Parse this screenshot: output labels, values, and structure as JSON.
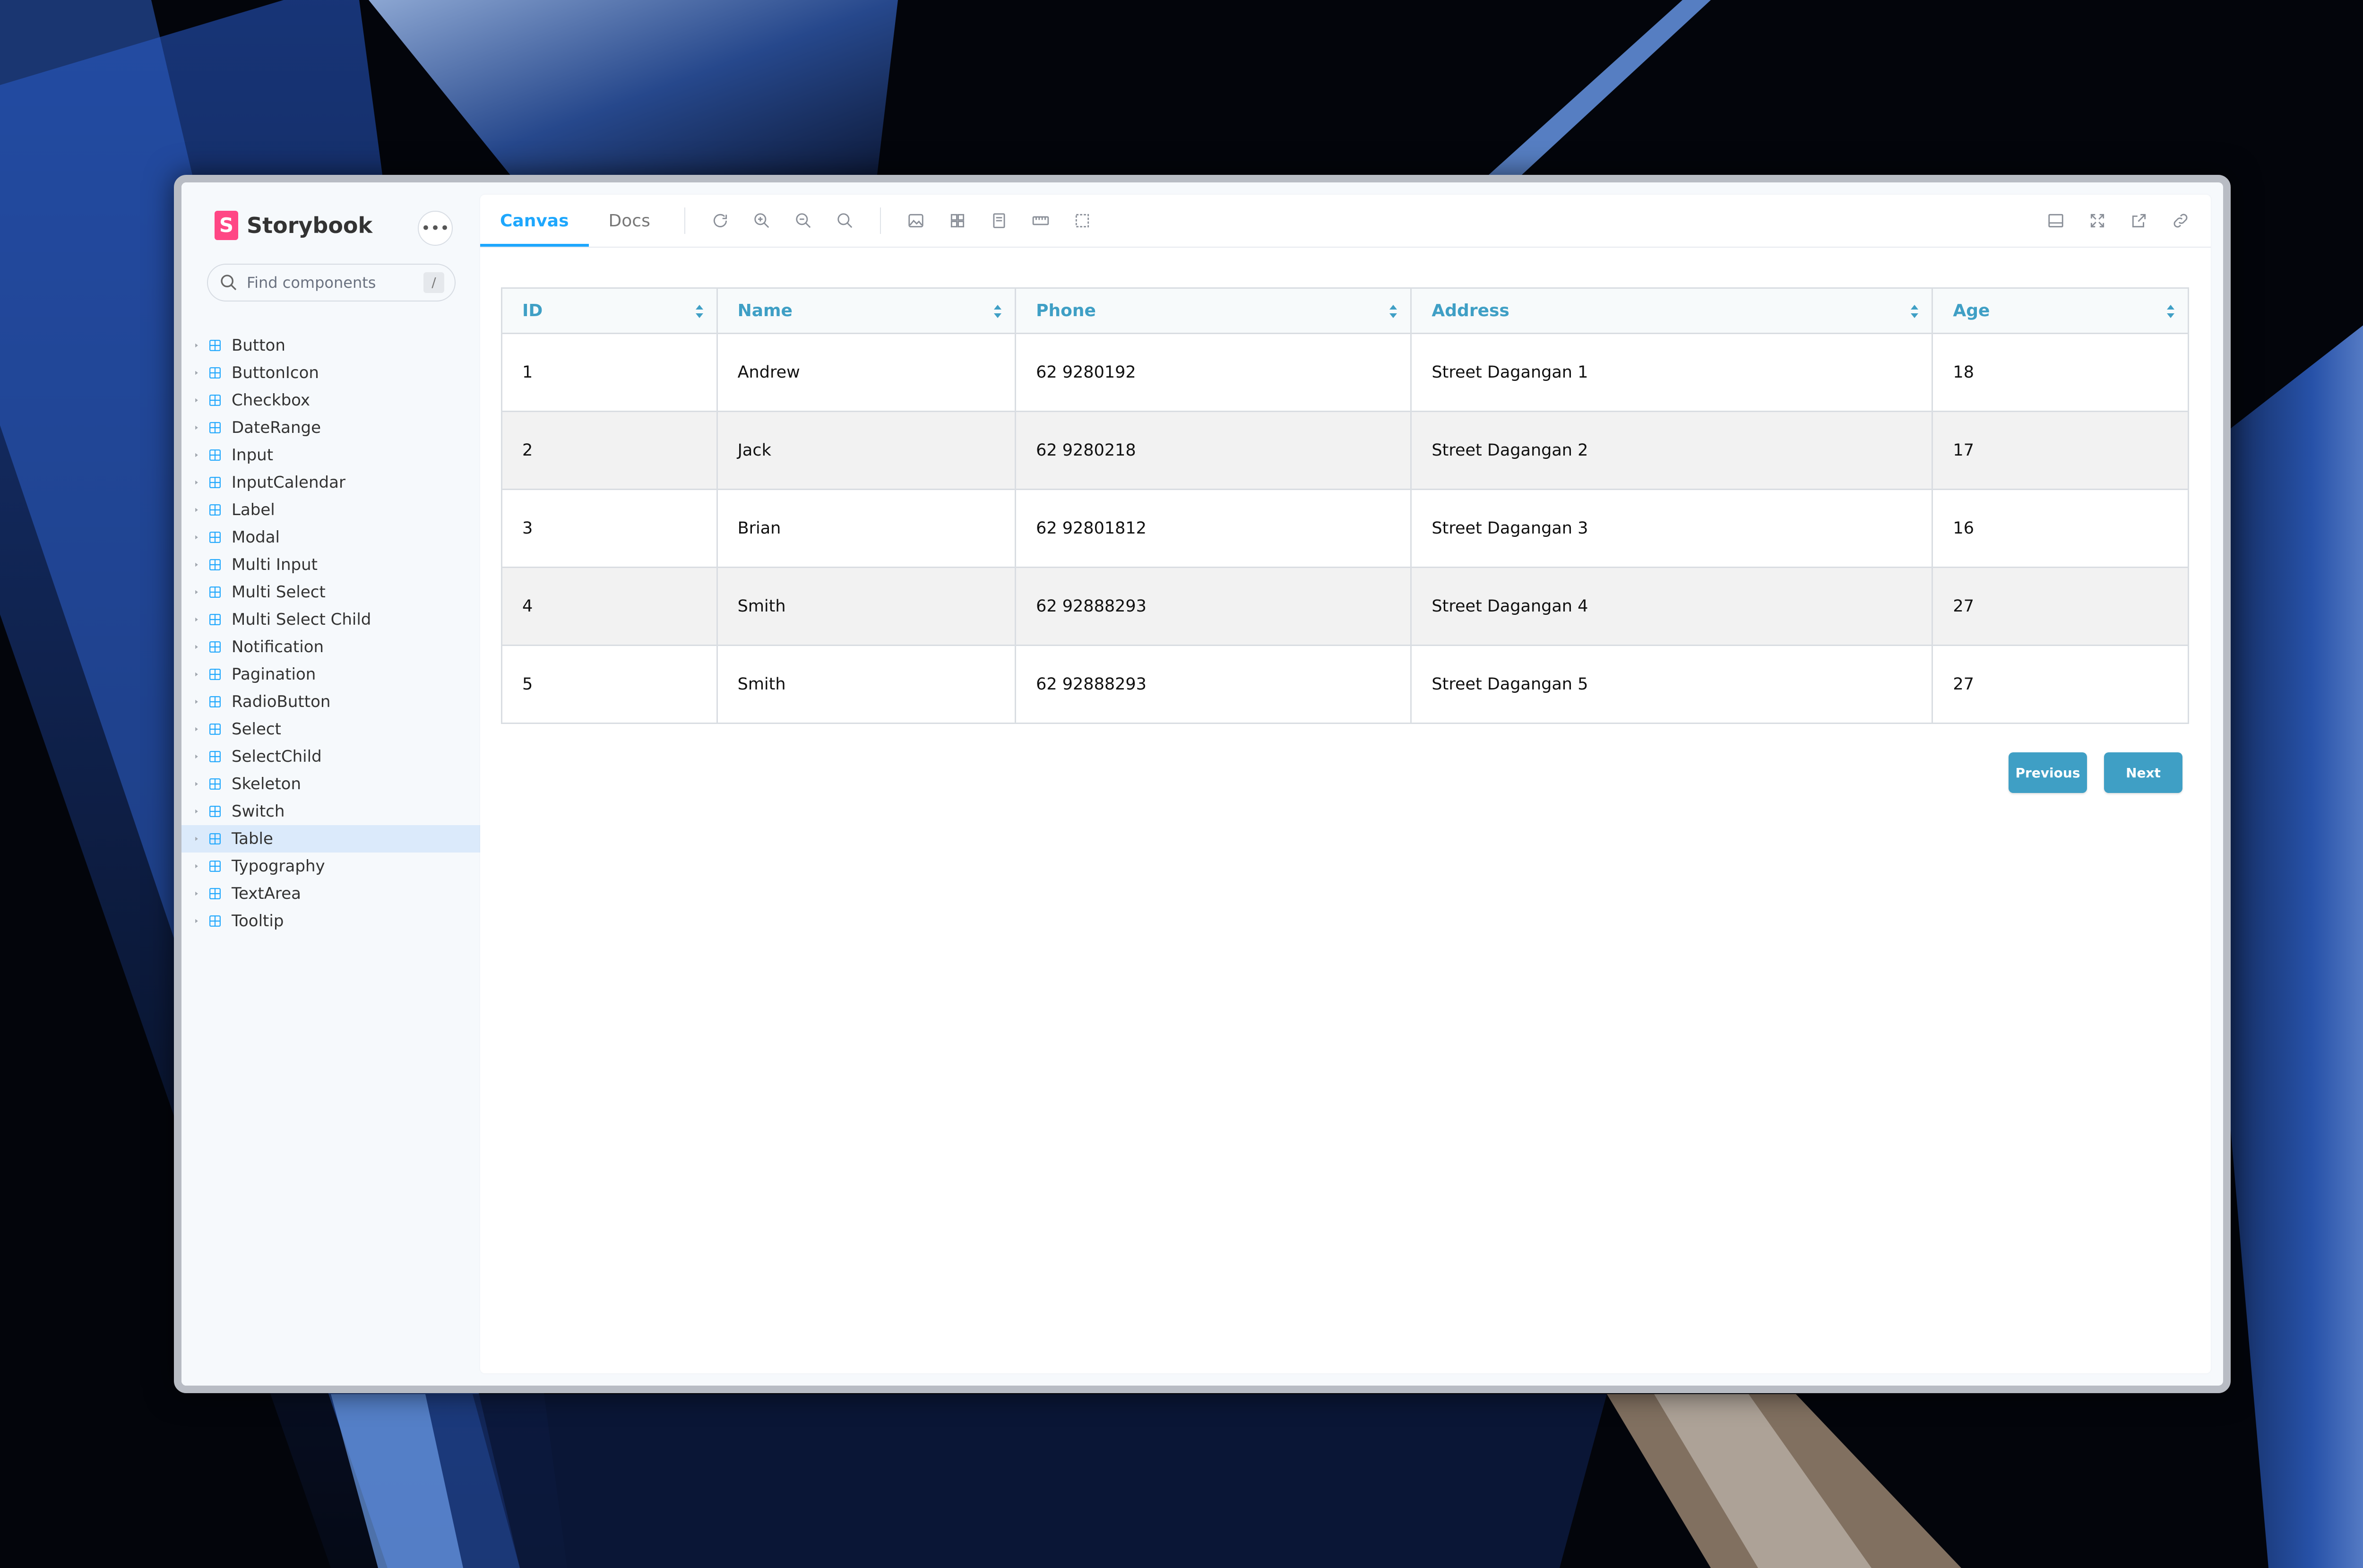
{
  "sidebar": {
    "brand": "Storybook",
    "search_placeholder": "Find components",
    "search_shortcut": "/",
    "items": [
      {
        "label": "Button"
      },
      {
        "label": "ButtonIcon"
      },
      {
        "label": "Checkbox"
      },
      {
        "label": "DateRange"
      },
      {
        "label": "Input"
      },
      {
        "label": "InputCalendar"
      },
      {
        "label": "Label"
      },
      {
        "label": "Modal"
      },
      {
        "label": "Multi Input"
      },
      {
        "label": "Multi Select"
      },
      {
        "label": "Multi Select Child"
      },
      {
        "label": "Notification"
      },
      {
        "label": "Pagination"
      },
      {
        "label": "RadioButton"
      },
      {
        "label": "Select"
      },
      {
        "label": "SelectChild"
      },
      {
        "label": "Skeleton"
      },
      {
        "label": "Switch"
      },
      {
        "label": "Table",
        "active": true
      },
      {
        "label": "Typography"
      },
      {
        "label": "TextArea"
      },
      {
        "label": "Tooltip"
      }
    ]
  },
  "toolbar": {
    "tabs": [
      {
        "label": "Canvas",
        "active": true
      },
      {
        "label": "Docs"
      }
    ]
  },
  "table": {
    "columns": [
      "ID",
      "Name",
      "Phone",
      "Address",
      "Age"
    ],
    "rows": [
      [
        "1",
        "Andrew",
        "62 9280192",
        "Street Dagangan 1",
        "18"
      ],
      [
        "2",
        "Jack",
        "62 9280218",
        "Street Dagangan 2",
        "17"
      ],
      [
        "3",
        "Brian",
        "62 92801812",
        "Street Dagangan 3",
        "16"
      ],
      [
        "4",
        "Smith",
        "62 92888293",
        "Street Dagangan 4",
        "27"
      ],
      [
        "5",
        "Smith",
        "62 92888293",
        "Street Dagangan 5",
        "27"
      ]
    ]
  },
  "pagination": {
    "previous_label": "Previous",
    "next_label": "Next"
  },
  "colors": {
    "accent": "#1ea7fd",
    "table_header_text": "#3f9fc5",
    "button_bg": "#3f9fc5",
    "storybook_pink": "#ff4785"
  }
}
